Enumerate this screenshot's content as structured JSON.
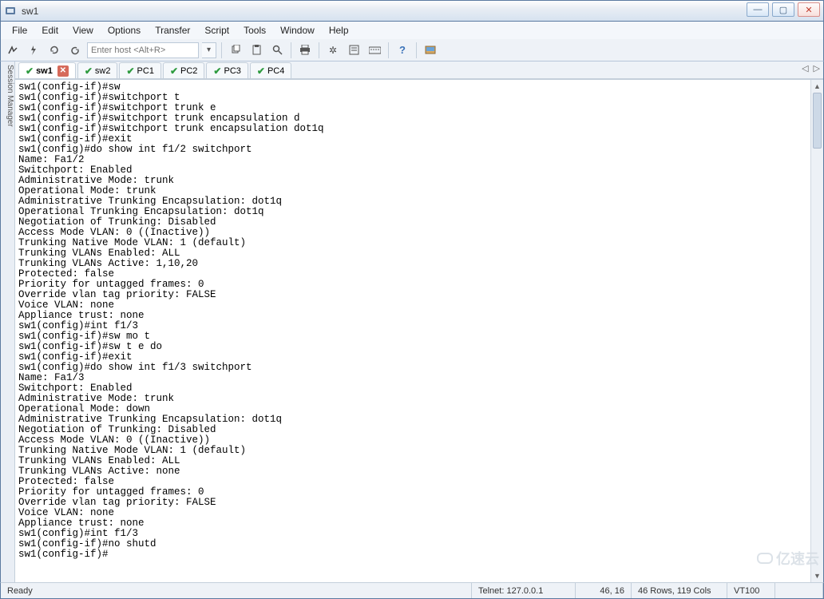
{
  "window": {
    "title": "sw1"
  },
  "menubar": [
    "File",
    "Edit",
    "View",
    "Options",
    "Transfer",
    "Script",
    "Tools",
    "Window",
    "Help"
  ],
  "toolbar": {
    "host_placeholder": "Enter host <Alt+R>"
  },
  "side_panel": "Session Manager",
  "tabs": [
    {
      "label": "sw1",
      "active": true,
      "closable": true
    },
    {
      "label": "sw2",
      "active": false,
      "closable": false
    },
    {
      "label": "PC1",
      "active": false,
      "closable": false
    },
    {
      "label": "PC2",
      "active": false,
      "closable": false
    },
    {
      "label": "PC3",
      "active": false,
      "closable": false
    },
    {
      "label": "PC4",
      "active": false,
      "closable": false
    }
  ],
  "terminal_lines": [
    "sw1(config-if)#sw",
    "sw1(config-if)#switchport t",
    "sw1(config-if)#switchport trunk e",
    "sw1(config-if)#switchport trunk encapsulation d",
    "sw1(config-if)#switchport trunk encapsulation dot1q",
    "sw1(config-if)#exit",
    "sw1(config)#do show int f1/2 switchport",
    "Name: Fa1/2",
    "Switchport: Enabled",
    "Administrative Mode: trunk",
    "Operational Mode: trunk",
    "Administrative Trunking Encapsulation: dot1q",
    "Operational Trunking Encapsulation: dot1q",
    "Negotiation of Trunking: Disabled",
    "Access Mode VLAN: 0 ((Inactive))",
    "Trunking Native Mode VLAN: 1 (default)",
    "Trunking VLANs Enabled: ALL",
    "Trunking VLANs Active: 1,10,20",
    "Protected: false",
    "Priority for untagged frames: 0",
    "Override vlan tag priority: FALSE",
    "Voice VLAN: none",
    "Appliance trust: none",
    "sw1(config)#int f1/3",
    "sw1(config-if)#sw mo t",
    "sw1(config-if)#sw t e do",
    "sw1(config-if)#exit",
    "sw1(config)#do show int f1/3 switchport",
    "Name: Fa1/3",
    "Switchport: Enabled",
    "Administrative Mode: trunk",
    "Operational Mode: down",
    "Administrative Trunking Encapsulation: dot1q",
    "Negotiation of Trunking: Disabled",
    "Access Mode VLAN: 0 ((Inactive))",
    "Trunking Native Mode VLAN: 1 (default)",
    "Trunking VLANs Enabled: ALL",
    "Trunking VLANs Active: none",
    "Protected: false",
    "Priority for untagged frames: 0",
    "Override vlan tag priority: FALSE",
    "Voice VLAN: none",
    "Appliance trust: none",
    "sw1(config)#int f1/3",
    "sw1(config-if)#no shutd",
    "sw1(config-if)#"
  ],
  "status": {
    "ready": "Ready",
    "protocol": "Telnet: 127.0.0.1",
    "cursor": "46, 16",
    "size": "46 Rows, 119 Cols",
    "emulation": "VT100"
  },
  "watermark": "亿速云"
}
